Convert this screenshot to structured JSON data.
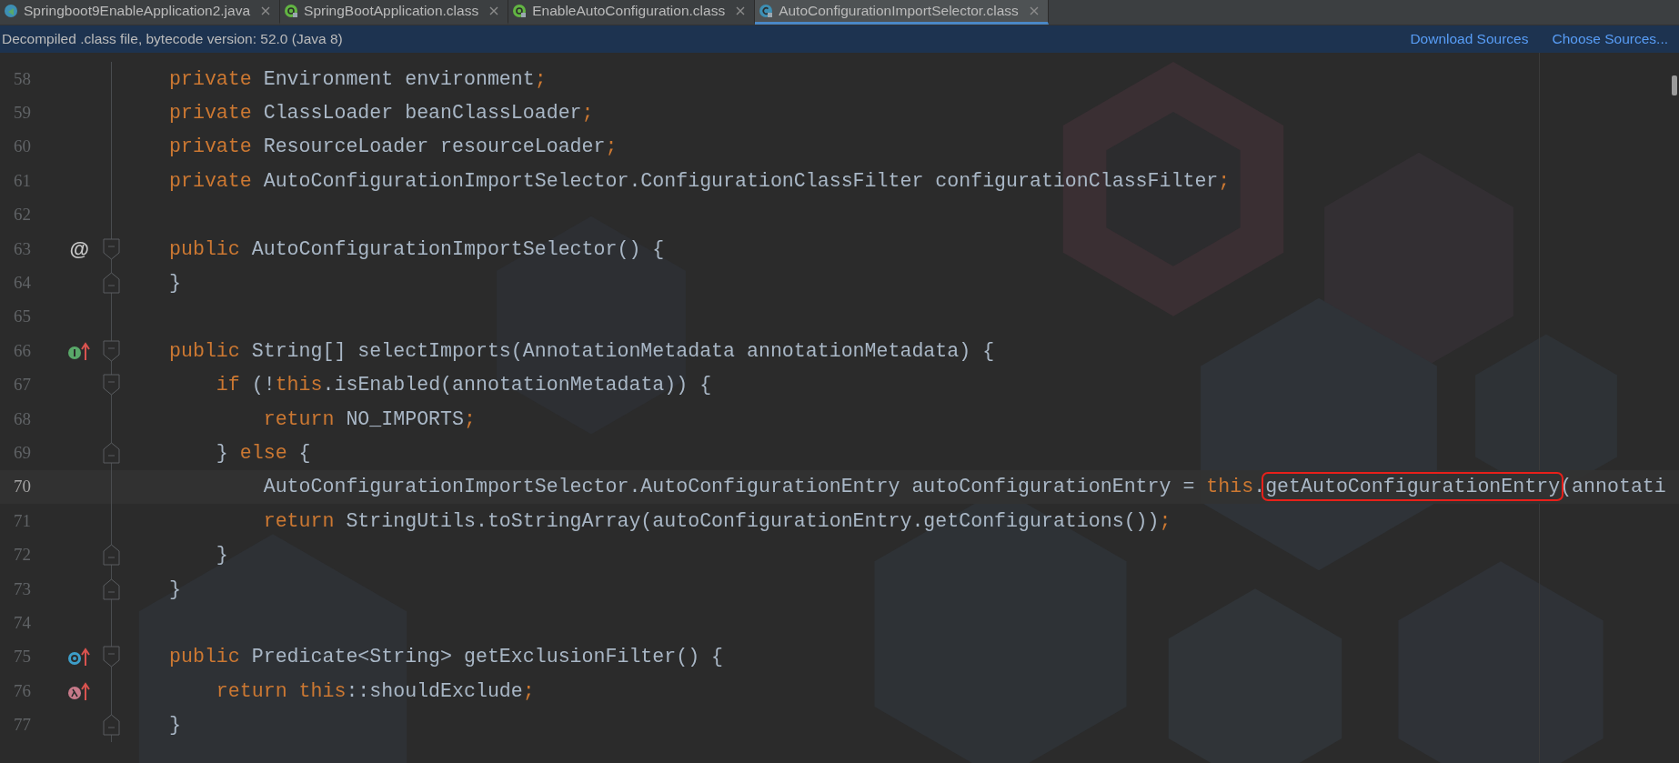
{
  "tabs": [
    {
      "label": "Springboot9EnableApplication2.java",
      "kind": "java",
      "selected": false
    },
    {
      "label": "SpringBootApplication.class",
      "kind": "annotation",
      "selected": false
    },
    {
      "label": "EnableAutoConfiguration.class",
      "kind": "annotation",
      "selected": false
    },
    {
      "label": "AutoConfigurationImportSelector.class",
      "kind": "class",
      "selected": true
    }
  ],
  "banner": {
    "text": "Decompiled .class file, bytecode version: 52.0 (Java 8)",
    "links": [
      "Download Sources",
      "Choose Sources..."
    ]
  },
  "lines": [
    {
      "number": "58",
      "current": false,
      "tokens": [
        {
          "kind": "keyword",
          "text": "private"
        },
        {
          "kind": "text",
          "text": " Environment environment"
        },
        {
          "kind": "keyword",
          "text": ";"
        }
      ]
    },
    {
      "number": "59",
      "current": false,
      "tokens": [
        {
          "kind": "keyword",
          "text": "private"
        },
        {
          "kind": "text",
          "text": " ClassLoader beanClassLoader"
        },
        {
          "kind": "keyword",
          "text": ";"
        }
      ]
    },
    {
      "number": "60",
      "current": false,
      "tokens": [
        {
          "kind": "keyword",
          "text": "private"
        },
        {
          "kind": "text",
          "text": " ResourceLoader resourceLoader"
        },
        {
          "kind": "keyword",
          "text": ";"
        }
      ]
    },
    {
      "number": "61",
      "current": false,
      "tokens": [
        {
          "kind": "keyword",
          "text": "private"
        },
        {
          "kind": "text",
          "text": " AutoConfigurationImportSelector.ConfigurationClassFilter configurationClassFilter"
        },
        {
          "kind": "keyword",
          "text": ";"
        }
      ]
    },
    {
      "number": "62",
      "current": false
    },
    {
      "number": "63",
      "current": false,
      "marker": {
        "kind": "annotation",
        "text": "@"
      },
      "fold": {
        "kind": "start"
      },
      "tokens": [
        {
          "kind": "keyword",
          "text": "public"
        },
        {
          "kind": "text",
          "text": " AutoConfigurationImportSelector() {"
        }
      ]
    },
    {
      "number": "64",
      "current": false,
      "fold": {
        "kind": "end"
      },
      "tokens": [
        {
          "kind": "text",
          "text": "}"
        }
      ]
    },
    {
      "number": "65",
      "current": false
    },
    {
      "number": "66",
      "current": false,
      "marker": {
        "kind": "implements"
      },
      "fold": {
        "kind": "start"
      },
      "tokens": [
        {
          "kind": "keyword",
          "text": "public"
        },
        {
          "kind": "text",
          "text": " String[] selectImports(AnnotationMetadata annotationMetadata) {"
        }
      ]
    },
    {
      "number": "67",
      "current": false,
      "fold": {
        "kind": "start"
      },
      "tokens": [
        {
          "kind": "keyword",
          "text": "    if"
        },
        {
          "kind": "text",
          "text": " (!"
        },
        {
          "kind": "keyword",
          "text": "this"
        },
        {
          "kind": "text",
          "text": ".isEnabled(annotationMetadata)) {"
        }
      ]
    },
    {
      "number": "68",
      "current": false,
      "tokens": [
        {
          "kind": "keyword",
          "text": "        return"
        },
        {
          "kind": "text",
          "text": " NO_IMPORTS"
        },
        {
          "kind": "keyword",
          "text": ";"
        }
      ]
    },
    {
      "number": "69",
      "current": false,
      "fold": {
        "kind": "end"
      },
      "tokens": [
        {
          "kind": "text",
          "text": "    } "
        },
        {
          "kind": "keyword",
          "text": "else"
        },
        {
          "kind": "text",
          "text": " {"
        }
      ]
    },
    {
      "number": "70",
      "current": true,
      "tokens": [
        {
          "kind": "text",
          "text": "        AutoConfigurationImportSelector.AutoConfigurationEntry autoConfigurationEntry = "
        },
        {
          "kind": "keyword",
          "text": "this"
        },
        {
          "kind": "text",
          "text": "."
        },
        {
          "kind": "boxed",
          "text": "getAutoConfigurationEntry"
        },
        {
          "kind": "text",
          "text": "(annotati"
        }
      ]
    },
    {
      "number": "71",
      "current": false,
      "tokens": [
        {
          "kind": "keyword",
          "text": "        return"
        },
        {
          "kind": "text",
          "text": " StringUtils.toStringArray(autoConfigurationEntry.getConfigurations())"
        },
        {
          "kind": "keyword",
          "text": ";"
        }
      ]
    },
    {
      "number": "72",
      "current": false,
      "fold": {
        "kind": "end"
      },
      "tokens": [
        {
          "kind": "text",
          "text": "    }"
        }
      ]
    },
    {
      "number": "73",
      "current": false,
      "fold": {
        "kind": "end"
      },
      "tokens": [
        {
          "kind": "text",
          "text": "}"
        }
      ]
    },
    {
      "number": "74",
      "current": false
    },
    {
      "number": "75",
      "current": false,
      "marker": {
        "kind": "overrides"
      },
      "fold": {
        "kind": "start"
      },
      "tokens": [
        {
          "kind": "keyword",
          "text": "public"
        },
        {
          "kind": "text",
          "text": " Predicate<String> getExclusionFilter() {"
        }
      ]
    },
    {
      "number": "76",
      "current": false,
      "marker": {
        "kind": "lambda"
      },
      "tokens": [
        {
          "kind": "keyword",
          "text": "    return this"
        },
        {
          "kind": "text",
          "text": "::shouldExclude"
        },
        {
          "kind": "keyword",
          "text": ";"
        }
      ]
    },
    {
      "number": "77",
      "current": false,
      "fold": {
        "kind": "end"
      },
      "tokens": [
        {
          "kind": "text",
          "text": "}"
        }
      ]
    }
  ]
}
